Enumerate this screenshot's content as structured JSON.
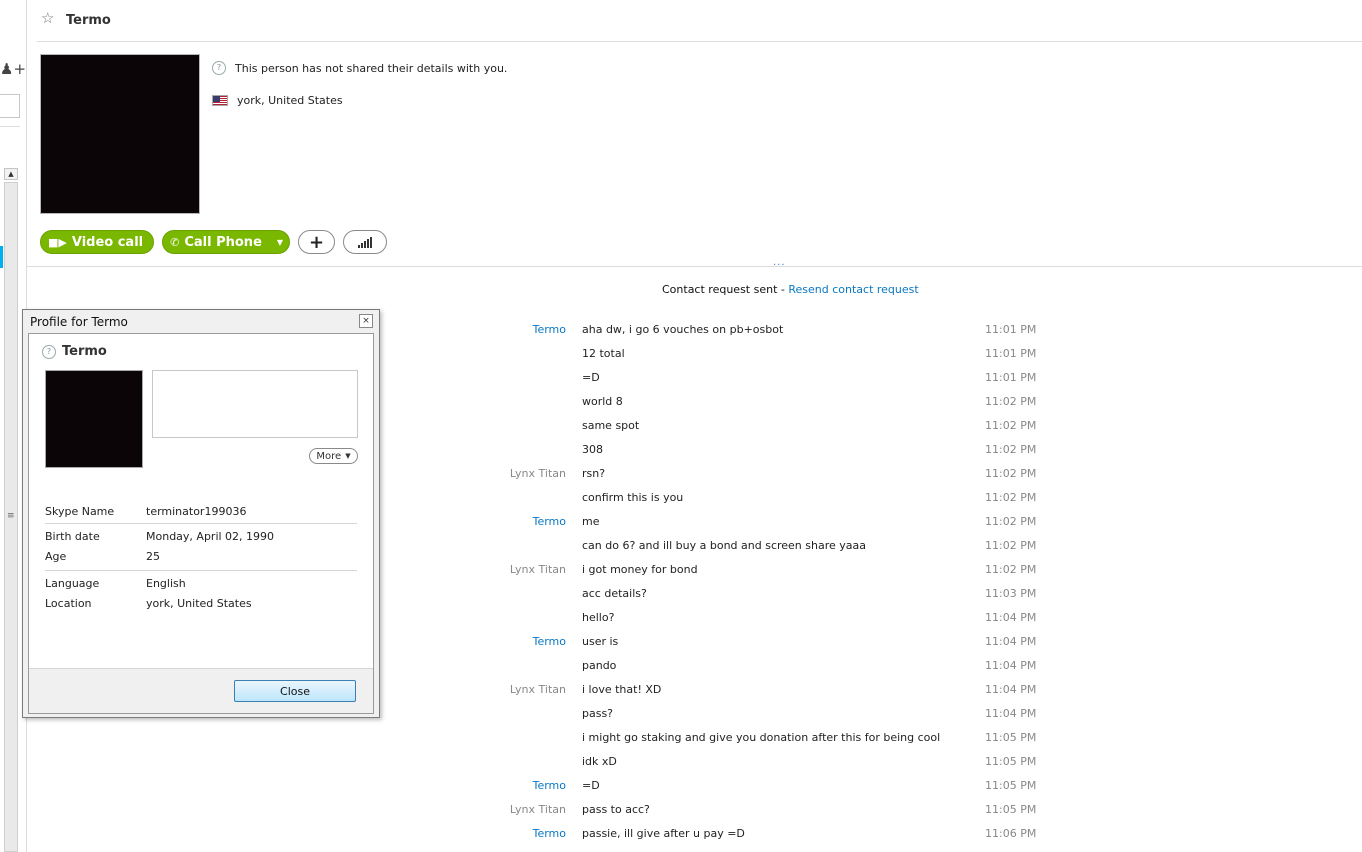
{
  "contact": {
    "name": "Termo",
    "details_notice": "This person has not shared their details with you.",
    "location": "york, United States"
  },
  "actions": {
    "video_call": "Video call",
    "call_phone": "Call Phone"
  },
  "conversation": {
    "request_status": "Contact request sent - ",
    "resend_link": "Resend contact request",
    "messages": [
      {
        "sender": "Termo",
        "text": "aha dw, i go 6 vouches on pb+osbot",
        "time": "11:01 PM"
      },
      {
        "sender": "",
        "text": "12 total",
        "time": "11:01 PM"
      },
      {
        "sender": "",
        "text": "=D",
        "time": "11:01 PM"
      },
      {
        "sender": "",
        "text": "world 8",
        "time": "11:02 PM"
      },
      {
        "sender": "",
        "text": "same spot",
        "time": "11:02 PM"
      },
      {
        "sender": "",
        "text": "308",
        "time": "11:02 PM"
      },
      {
        "sender": "Lynx Titan",
        "text": "rsn?",
        "time": "11:02 PM"
      },
      {
        "sender": "",
        "text": "confirm this is you",
        "time": "11:02 PM"
      },
      {
        "sender": "Termo",
        "text": "me",
        "time": "11:02 PM"
      },
      {
        "sender": "",
        "text": "can do 6? and ill buy a bond and screen share yaaa",
        "time": "11:02 PM"
      },
      {
        "sender": "Lynx Titan",
        "text": "i got money for bond",
        "time": "11:02 PM"
      },
      {
        "sender": "",
        "text": "acc details?",
        "time": "11:03 PM"
      },
      {
        "sender": "",
        "text": "hello?",
        "time": "11:04 PM"
      },
      {
        "sender": "Termo",
        "text": "user is",
        "time": "11:04 PM"
      },
      {
        "sender": "",
        "text": "pando",
        "time": "11:04 PM"
      },
      {
        "sender": "Lynx Titan",
        "text": "i love that! XD",
        "time": "11:04 PM"
      },
      {
        "sender": "",
        "text": "pass?",
        "time": "11:04 PM"
      },
      {
        "sender": "",
        "text": "i might go staking and give you donation after this for being cool",
        "time": "11:05 PM"
      },
      {
        "sender": "",
        "text": "idk xD",
        "time": "11:05 PM"
      },
      {
        "sender": "Termo",
        "text": "=D",
        "time": "11:05 PM"
      },
      {
        "sender": "Lynx Titan",
        "text": "pass to acc?",
        "time": "11:05 PM"
      },
      {
        "sender": "Termo",
        "text": "passie, ill give after u pay =D",
        "time": "11:06 PM"
      }
    ]
  },
  "profile_dialog": {
    "title": "Profile for Termo",
    "name": "Termo",
    "more_label": "More",
    "fields": {
      "skype_name_label": "Skype Name",
      "skype_name": "terminator199036",
      "birth_date_label": "Birth date",
      "birth_date": "Monday, April 02, 1990",
      "age_label": "Age",
      "age": "25",
      "language_label": "Language",
      "language": "English",
      "location_label": "Location",
      "location": "york, United States"
    },
    "close_label": "Close"
  },
  "colors": {
    "accent_green": "#7ab800",
    "link_blue": "#0a77c2",
    "skype_blue": "#00aff0"
  }
}
